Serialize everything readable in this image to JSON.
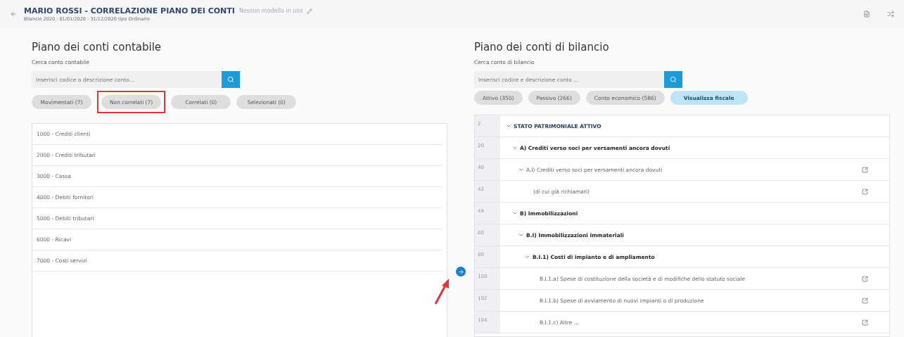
{
  "header": {
    "title": "MARIO ROSSI - CORRELAZIONE PIANO DEI CONTI",
    "model": "Nessun modello in uso",
    "subtitle": "Bilancio 2020 : 01/01/2020 - 31/12/2020 tipo Ordinario"
  },
  "left": {
    "title": "Piano dei conti contabile",
    "search_label": "Cerca conto contabile",
    "placeholder": "Inserisci codice o descrizione conto...",
    "filters": [
      {
        "label": "Movimentati (7)",
        "selected": false,
        "highlighted": false
      },
      {
        "label": "Non correlati (7)",
        "selected": false,
        "highlighted": true
      },
      {
        "label": "Correlati (0)",
        "selected": false,
        "highlighted": false
      },
      {
        "label": "Selezionati (0)",
        "selected": false,
        "highlighted": false
      }
    ],
    "accounts": [
      "1000 - Crediti clienti",
      "2000 - Crediti tributari",
      "3000 - Cassa",
      "4000 - Debiti fornitori",
      "5000 - Debiti tributari",
      "6000 - Ricavi",
      "7000 - Costi servizi"
    ]
  },
  "right": {
    "title": "Piano dei conti di bilancio",
    "search_label": "Cerca conto di bilancio",
    "placeholder": "Inserisci codice e descrizione conto ...",
    "filters": [
      {
        "label": "Attivo (350)",
        "selected": false
      },
      {
        "label": "Passivo (266)",
        "selected": false
      },
      {
        "label": "Conto economico (586)",
        "selected": false
      },
      {
        "label": "Visualizza fiscale",
        "selected": true
      }
    ],
    "tree": [
      {
        "code": "2",
        "label": "STATO PATRIMONIALE ATTIVO",
        "kind": "header",
        "expanded": true,
        "children": [
          {
            "code": "20",
            "label": "A) Crediti verso soci per versamenti ancora dovuti",
            "kind": "section",
            "expanded": true,
            "children": [
              {
                "code": "40",
                "label": "A.I) Crediti verso soci per versamenti ancora dovuti",
                "kind": "account",
                "expanded": true,
                "children": [
                  {
                    "code": "42",
                    "label": "(di cui già richiamati)",
                    "kind": "account"
                  }
                ]
              }
            ]
          },
          {
            "code": "44",
            "label": "B) Immobilizzazioni",
            "kind": "section",
            "expanded": true,
            "children": [
              {
                "code": "60",
                "label": "B.I) Immobilizzazioni immateriali",
                "kind": "section",
                "expanded": true,
                "children": [
                  {
                    "code": "80",
                    "label": "B.I.1) Costi di impianto e di ampliamento",
                    "kind": "section",
                    "expanded": true,
                    "children": [
                      {
                        "code": "100",
                        "label": "B.I.1.a) Spese di costituzione della società e di modifiche dello statuto sociale",
                        "kind": "account"
                      },
                      {
                        "code": "102",
                        "label": "B.I.1.b) Spese di avviamento di nuovi impianti o di produzione",
                        "kind": "account"
                      },
                      {
                        "code": "104",
                        "label": "B.I.1.c) Altre ...",
                        "kind": "account"
                      }
                    ]
                  }
                ]
              }
            ]
          }
        ]
      }
    ]
  }
}
